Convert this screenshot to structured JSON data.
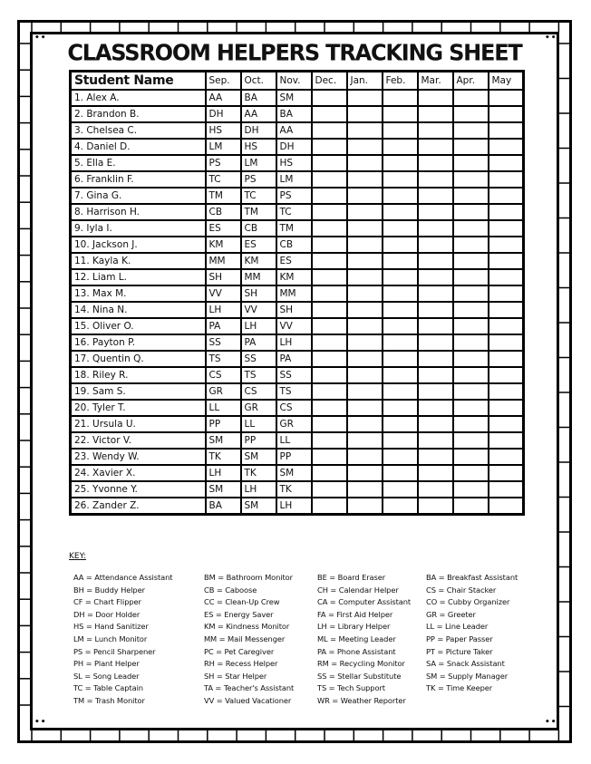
{
  "title": "CLASSROOM HELPERS TRACKING SHEET",
  "table": {
    "headers": [
      "Student Name",
      "Sep.",
      "Oct.",
      "Nov.",
      "Dec.",
      "Jan.",
      "Feb.",
      "Mar.",
      "Apr.",
      "May"
    ],
    "rows": [
      {
        "name": "1. Alex A.",
        "months": [
          "AA",
          "BA",
          "SM",
          "",
          "",
          "",
          "",
          "",
          ""
        ]
      },
      {
        "name": "2. Brandon B.",
        "months": [
          "DH",
          "AA",
          "BA",
          "",
          "",
          "",
          "",
          "",
          ""
        ]
      },
      {
        "name": "3. Chelsea C.",
        "months": [
          "HS",
          "DH",
          "AA",
          "",
          "",
          "",
          "",
          "",
          ""
        ]
      },
      {
        "name": "4. Daniel D.",
        "months": [
          "LM",
          "HS",
          "DH",
          "",
          "",
          "",
          "",
          "",
          ""
        ]
      },
      {
        "name": "5. Ella E.",
        "months": [
          "PS",
          "LM",
          "HS",
          "",
          "",
          "",
          "",
          "",
          ""
        ]
      },
      {
        "name": "6. Franklin F.",
        "months": [
          "TC",
          "PS",
          "LM",
          "",
          "",
          "",
          "",
          "",
          ""
        ]
      },
      {
        "name": "7. Gina G.",
        "months": [
          "TM",
          "TC",
          "PS",
          "",
          "",
          "",
          "",
          "",
          ""
        ]
      },
      {
        "name": "8. Harrison H.",
        "months": [
          "CB",
          "TM",
          "TC",
          "",
          "",
          "",
          "",
          "",
          ""
        ]
      },
      {
        "name": "9. Iyla I.",
        "months": [
          "ES",
          "CB",
          "TM",
          "",
          "",
          "",
          "",
          "",
          ""
        ]
      },
      {
        "name": "10. Jackson J.",
        "months": [
          "KM",
          "ES",
          "CB",
          "",
          "",
          "",
          "",
          "",
          ""
        ]
      },
      {
        "name": "11. Kayla K.",
        "months": [
          "MM",
          "KM",
          "ES",
          "",
          "",
          "",
          "",
          "",
          ""
        ]
      },
      {
        "name": "12. Liam L.",
        "months": [
          "SH",
          "MM",
          "KM",
          "",
          "",
          "",
          "",
          "",
          ""
        ]
      },
      {
        "name": "13. Max M.",
        "months": [
          "VV",
          "SH",
          "MM",
          "",
          "",
          "",
          "",
          "",
          ""
        ]
      },
      {
        "name": "14. Nina N.",
        "months": [
          "LH",
          "VV",
          "SH",
          "",
          "",
          "",
          "",
          "",
          ""
        ]
      },
      {
        "name": "15. Oliver O.",
        "months": [
          "PA",
          "LH",
          "VV",
          "",
          "",
          "",
          "",
          "",
          ""
        ]
      },
      {
        "name": "16. Payton P.",
        "months": [
          "SS",
          "PA",
          "LH",
          "",
          "",
          "",
          "",
          "",
          ""
        ]
      },
      {
        "name": "17. Quentin Q.",
        "months": [
          "TS",
          "SS",
          "PA",
          "",
          "",
          "",
          "",
          "",
          ""
        ]
      },
      {
        "name": "18. Riley R.",
        "months": [
          "CS",
          "TS",
          "SS",
          "",
          "",
          "",
          "",
          "",
          ""
        ]
      },
      {
        "name": "19. Sam S.",
        "months": [
          "GR",
          "CS",
          "TS",
          "",
          "",
          "",
          "",
          "",
          ""
        ]
      },
      {
        "name": "20. Tyler T.",
        "months": [
          "LL",
          "GR",
          "CS",
          "",
          "",
          "",
          "",
          "",
          ""
        ]
      },
      {
        "name": "21. Ursula U.",
        "months": [
          "PP",
          "LL",
          "GR",
          "",
          "",
          "",
          "",
          "",
          ""
        ]
      },
      {
        "name": "22. Victor V.",
        "months": [
          "SM",
          "PP",
          "LL",
          "",
          "",
          "",
          "",
          "",
          ""
        ]
      },
      {
        "name": "23. Wendy W.",
        "months": [
          "TK",
          "SM",
          "PP",
          "",
          "",
          "",
          "",
          "",
          ""
        ]
      },
      {
        "name": "24. Xavier X.",
        "months": [
          "LH",
          "TK",
          "SM",
          "",
          "",
          "",
          "",
          "",
          ""
        ]
      },
      {
        "name": "25. Yvonne Y.",
        "months": [
          "SM",
          "LH",
          "TK",
          "",
          "",
          "",
          "",
          "",
          ""
        ]
      },
      {
        "name": "26. Zander Z.",
        "months": [
          "BA",
          "SM",
          "LH",
          "",
          "",
          "",
          "",
          "",
          ""
        ]
      }
    ]
  },
  "key": {
    "label": "KEY:",
    "columns": [
      [
        "AA = Attendance Assistant",
        "BH = Buddy Helper",
        "CF = Chart Flipper",
        "DH = Door Holder",
        "HS = Hand Sanitizer",
        "LM = Lunch Monitor",
        "PS = Pencil Sharpener",
        "PH = Plant Helper",
        "SL = Song Leader",
        "TC = Table Captain",
        "TM = Trash Monitor"
      ],
      [
        "BM = Bathroom Monitor",
        "CB = Caboose",
        "CC = Clean-Up Crew",
        "ES = Energy Saver",
        "KM = Kindness Monitor",
        "MM = Mail Messenger",
        "PC = Pet Caregiver",
        "RH = Recess Helper",
        "SH = Star Helper",
        "TA = Teacher's Assistant",
        "VV = Valued Vacationer"
      ],
      [
        "BE = Board Eraser",
        "CH = Calendar Helper",
        "CA = Computer Assistant",
        "FA = First Aid Helper",
        "LH = Library Helper",
        "ML = Meeting Leader",
        "PA = Phone Assistant",
        "RM = Recycling Monitor",
        "SS = Stellar Substitute",
        "TS = Tech Support",
        "WR = Weather Reporter"
      ],
      [
        "BA = Breakfast Assistant",
        "CS = Chair Stacker",
        "CO = Cubby Organizer",
        "GR = Greeter",
        "LL = Line Leader",
        "PP = Paper Passer",
        "PT = Picture Taker",
        "SA = Snack Assistant",
        "SM = Supply Manager",
        "TK = Time Keeper"
      ]
    ]
  },
  "decor": {
    "corner_dots": "••"
  }
}
